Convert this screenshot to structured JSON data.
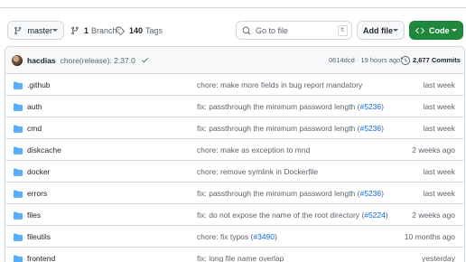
{
  "toolbar": {
    "branch": "master",
    "branches_count": "1",
    "branches_label": "Branch",
    "tags_count": "140",
    "tags_label": "Tags",
    "search_placeholder": "Go to file",
    "search_shortcut": "t",
    "add_file_label": "Add file",
    "code_label": "Code"
  },
  "latest_commit": {
    "author": "hacdias",
    "message": "chore(release): 2.37.0",
    "hash_time": "0614dcd · 19 hours ago",
    "commits_count": "2,677 Commits"
  },
  "files": [
    {
      "name": ".github",
      "message": "chore: make more fields in bug report mandatory",
      "link": "",
      "suffix": "",
      "date": "last week"
    },
    {
      "name": "auth",
      "message": "fix: passthrough the minimum password length (",
      "link": "#5236",
      "suffix": ")",
      "date": "last week"
    },
    {
      "name": "cmd",
      "message": "fix: passthrough the minimum password length (",
      "link": "#5236",
      "suffix": ")",
      "date": "last week"
    },
    {
      "name": "diskcache",
      "message": "chore: make as exception to mnd",
      "link": "",
      "suffix": "",
      "date": "2 weeks ago"
    },
    {
      "name": "docker",
      "message": "chore: remove symlink in Dockerfile",
      "link": "",
      "suffix": "",
      "date": "last week"
    },
    {
      "name": "errors",
      "message": "fix: passthrough the minimum password length (",
      "link": "#5236",
      "suffix": ")",
      "date": "last week"
    },
    {
      "name": "files",
      "message": "fix: do not expose the name of the root directory (",
      "link": "#5224",
      "suffix": ")",
      "date": "2 weeks ago"
    },
    {
      "name": "fileutils",
      "message": "chore: fix typos (",
      "link": "#3490",
      "suffix": ")",
      "date": "10 months ago"
    },
    {
      "name": "frontend",
      "message": "fix: long file name overlap",
      "link": "",
      "suffix": "",
      "date": "yesterday"
    }
  ],
  "colors": {
    "accent": "#1f883d",
    "link": "#0969da",
    "folder": "#54aeff"
  }
}
